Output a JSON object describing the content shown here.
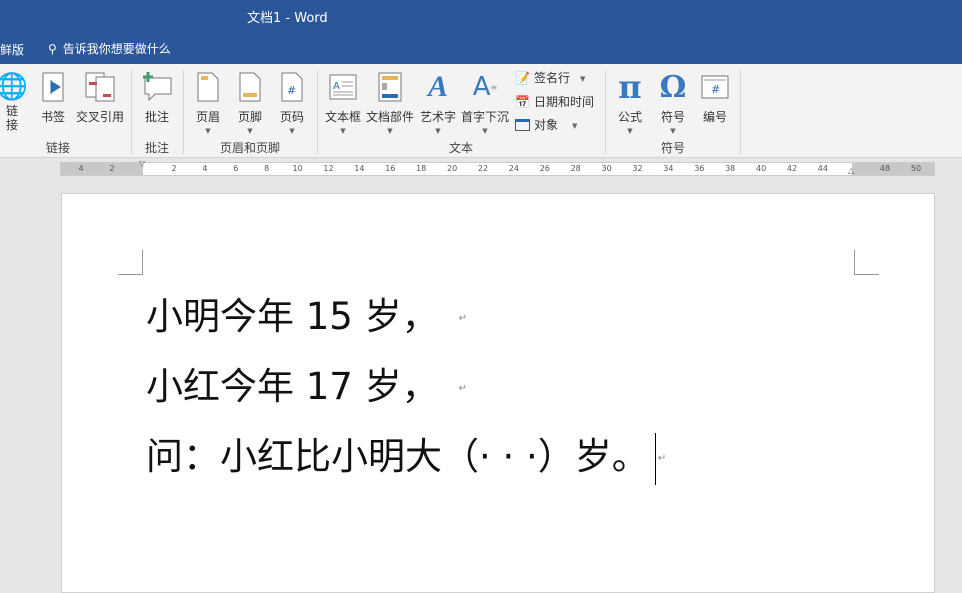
{
  "title": "文档1  -  Word",
  "tab_partial": "鲜版",
  "tell_me": "告诉我你想要做什么",
  "ribbon": {
    "buttons": {
      "link": "链\n接",
      "bookmark": "书签",
      "crossref": "交叉引用",
      "comment": "批注",
      "header": "页眉",
      "footer": "页脚",
      "pagenum": "页码",
      "textbox": "文本框",
      "quickparts": "文档部件",
      "wordart": "艺术字",
      "dropcap": "首字下沉",
      "signature": "签名行",
      "datetime": "日期和时间",
      "object": "对象",
      "equation": "公式",
      "symbol": "符号",
      "number": "编号"
    },
    "groups": {
      "links": "链接",
      "comments": "批注",
      "headerfooter": "页眉和页脚",
      "text": "文本",
      "symbols": "符号"
    }
  },
  "ruler": {
    "left": [
      "4",
      "2"
    ],
    "main": [
      "2",
      "4",
      "6",
      "8",
      "10",
      "12",
      "14",
      "16",
      "18",
      "20",
      "22",
      "24",
      "26",
      "28",
      "30",
      "32",
      "34",
      "36",
      "38",
      "40",
      "42",
      "44"
    ],
    "right": [
      "48",
      "50"
    ]
  },
  "document": {
    "lines": [
      "小明今年 15 岁，",
      "小红今年 17 岁，",
      "问：小红比小明大（· · ·）岁。"
    ]
  }
}
